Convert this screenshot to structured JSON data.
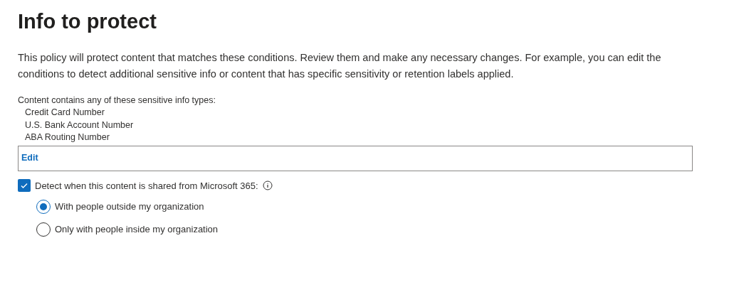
{
  "title": "Info to protect",
  "description": "This policy will protect content that matches these conditions. Review them and make any necessary changes. For example, you can edit the conditions to detect additional sensitive info or content that has specific sensitivity or retention labels applied.",
  "conditions": {
    "heading": "Content contains any of these sensitive info types:",
    "items": [
      "Credit Card Number",
      "U.S. Bank Account Number",
      "ABA Routing Number"
    ],
    "edit_link": "Edit"
  },
  "detect": {
    "label": "Detect when this content is shared from Microsoft 365:",
    "checked": true
  },
  "options": [
    {
      "label": "With people outside my organization",
      "selected": true
    },
    {
      "label": "Only with people inside my organization",
      "selected": false
    }
  ]
}
